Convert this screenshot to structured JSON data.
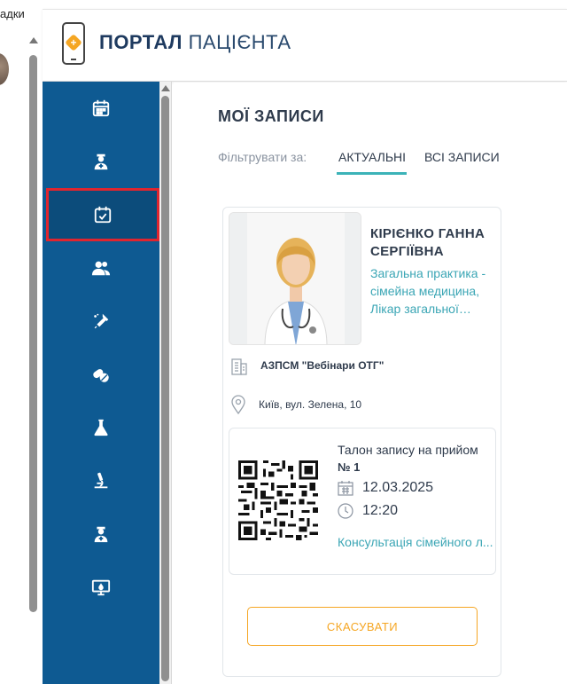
{
  "browser": {
    "tab_fragment": "адки"
  },
  "header": {
    "title_bold": "ПОРТАЛ",
    "title_regular": "ПАЦІЄНТА"
  },
  "sidebar": {
    "items": [
      {
        "icon": "calendar-icon",
        "active": false
      },
      {
        "icon": "doctor-icon",
        "active": false
      },
      {
        "icon": "calendar-check-icon",
        "active": true
      },
      {
        "icon": "users-icon",
        "active": false
      },
      {
        "icon": "vaccine-icon",
        "active": false
      },
      {
        "icon": "pills-icon",
        "active": false
      },
      {
        "icon": "flask-icon",
        "active": false
      },
      {
        "icon": "microscope-icon",
        "active": false
      },
      {
        "icon": "doctor-icon",
        "active": false
      },
      {
        "icon": "monitor-icon",
        "active": false
      }
    ],
    "color": "#0e5a92"
  },
  "main": {
    "title": "МОЇ ЗАПИСИ",
    "filter_label": "Фільтрувати за:",
    "tabs": [
      {
        "label": "АКТУАЛЬНІ",
        "active": true
      },
      {
        "label": "ВСІ ЗАПИСИ",
        "active": false
      }
    ],
    "appointment": {
      "doctor_name": "КІРІЄНКО ГАННА СЕРГІЇВНА",
      "specialty": "Загальна практика - сімейна медицина, Лікар загальної…",
      "clinic": "АЗПСМ \"Вебінари ОТГ\"",
      "address": "Київ, вул. Зелена, 10",
      "ticket": {
        "title": "Талон запису на прийом",
        "number": "№ 1",
        "date": "12.03.2025",
        "time": "12:20",
        "service": "Консультація сімейного л..."
      },
      "cancel_label": "СКАСУВАТИ"
    }
  },
  "colors": {
    "accent_teal": "#3bb3b8",
    "accent_orange": "#f5a623",
    "active_outline": "#e0252f"
  }
}
